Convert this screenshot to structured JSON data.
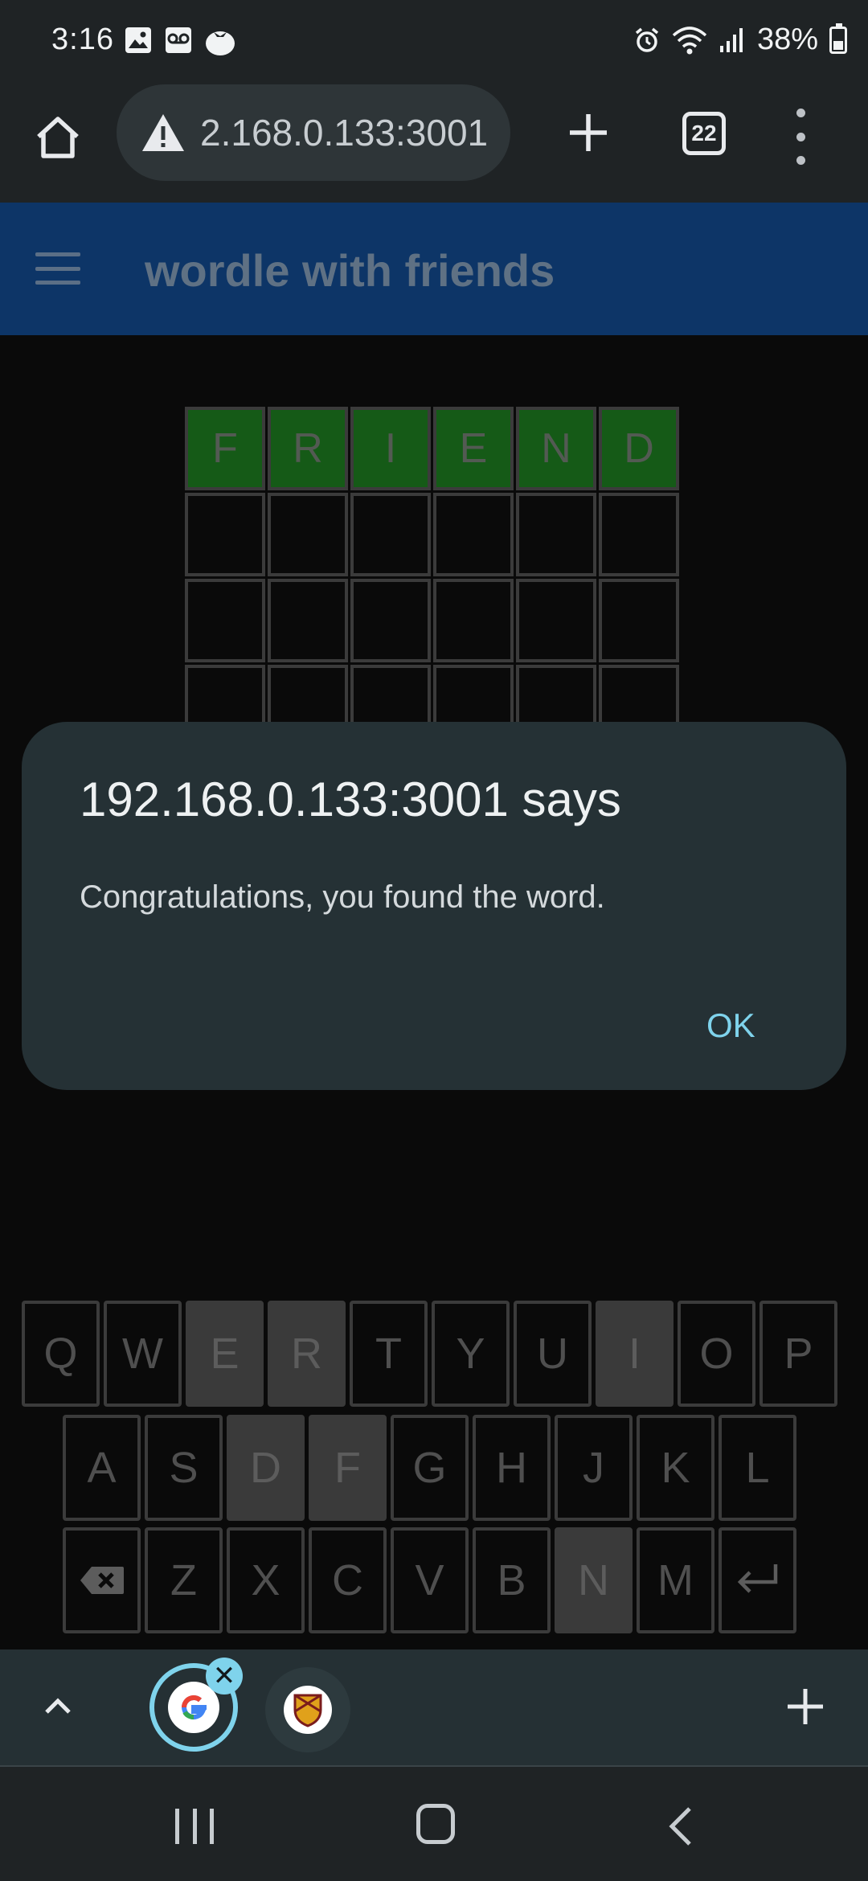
{
  "status_bar": {
    "time": "3:16",
    "battery": "38%",
    "icons_left": [
      "gallery-icon",
      "voicemail-icon",
      "tomato-icon"
    ],
    "icons_right": [
      "alarm-icon",
      "wifi-icon",
      "signal-icon",
      "battery-icon"
    ]
  },
  "browser": {
    "url": "192.168.0.133:3001",
    "url_visible": "2.168.0.133:3001",
    "tab_count": "22"
  },
  "app": {
    "title": "wordle with friends"
  },
  "grid": {
    "rows": [
      [
        "F",
        "R",
        "I",
        "E",
        "N",
        "D"
      ],
      [
        "",
        "",
        "",
        "",
        "",
        ""
      ],
      [
        "",
        "",
        "",
        "",
        "",
        ""
      ],
      [
        "",
        "",
        "",
        "",
        "",
        ""
      ]
    ],
    "solved_row": 0
  },
  "dialog": {
    "title": "192.168.0.133:3001 says",
    "message": "Congratulations, you found the word.",
    "ok_label": "OK"
  },
  "keyboard": {
    "row1": [
      "Q",
      "W",
      "E",
      "R",
      "T",
      "Y",
      "U",
      "I",
      "O",
      "P"
    ],
    "row2": [
      "A",
      "S",
      "D",
      "F",
      "G",
      "H",
      "J",
      "K",
      "L"
    ],
    "row3": [
      "backspace",
      "Z",
      "X",
      "C",
      "V",
      "B",
      "N",
      "M",
      "enter"
    ],
    "used_keys": [
      "E",
      "R",
      "I",
      "D",
      "F",
      "N"
    ]
  },
  "colors": {
    "correct": "#155a17",
    "app_bar": "#0d3567",
    "dialog_bg": "#253135",
    "accent": "#7fd3ec"
  }
}
